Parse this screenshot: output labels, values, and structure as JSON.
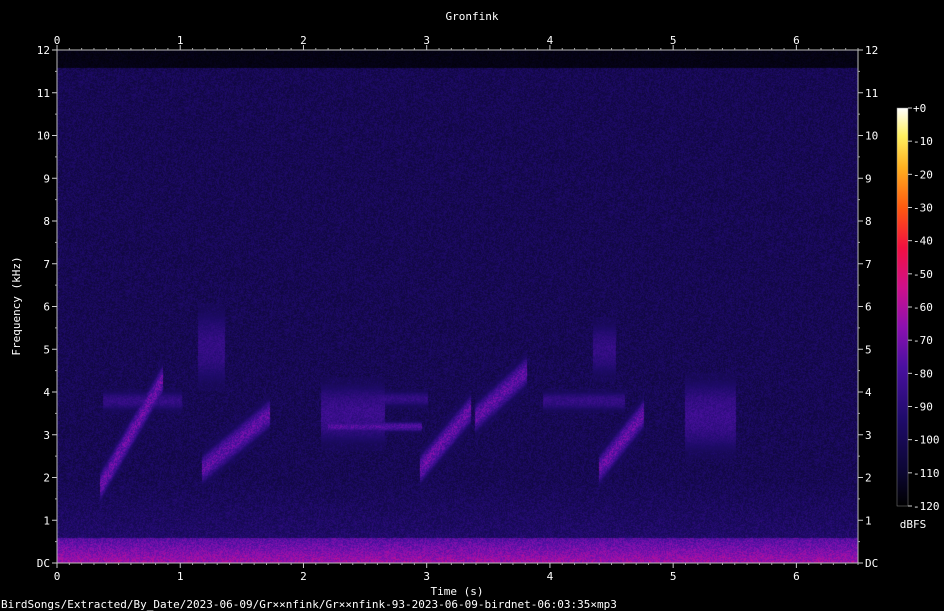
{
  "chart_data": {
    "type": "heatmap",
    "title": "Gronfink",
    "xlabel": "Time (s)",
    "ylabel": "Frequency (kHz)",
    "xlim": [
      0,
      6.5
    ],
    "ylim": [
      0,
      12
    ],
    "x_ticks": [
      "0",
      "1",
      "2",
      "3",
      "4",
      "5",
      "6"
    ],
    "y_ticks": [
      "DC",
      "1",
      "2",
      "3",
      "4",
      "5",
      "6",
      "7",
      "8",
      "9",
      "10",
      "11",
      "12"
    ],
    "colorbar": {
      "label": "dBFS",
      "range": [
        -120,
        0
      ],
      "ticks": [
        "+0",
        "-10",
        "-20",
        "-30",
        "-40",
        "-50",
        "-60",
        "-70",
        "-80",
        "-90",
        "-100",
        "-110",
        "-120"
      ]
    },
    "noise_floor_top_khz": 11.6,
    "low_freq_energy_below_khz": 0.6,
    "sound_events": [
      {
        "t_start": 0.35,
        "t_end": 0.85,
        "f_low": 1.8,
        "f_high": 4.3,
        "kind": "upsweep",
        "level_db": -70
      },
      {
        "t_start": 0.38,
        "t_end": 1.0,
        "f_low": 3.6,
        "f_high": 4.0,
        "kind": "band",
        "level_db": -85
      },
      {
        "t_start": 1.15,
        "t_end": 1.35,
        "f_low": 4.2,
        "f_high": 5.9,
        "kind": "click",
        "level_db": -85
      },
      {
        "t_start": 1.18,
        "t_end": 1.72,
        "f_low": 2.2,
        "f_high": 3.5,
        "kind": "upsweep",
        "level_db": -72
      },
      {
        "t_start": 2.15,
        "t_end": 2.65,
        "f_low": 2.8,
        "f_high": 4.2,
        "kind": "band",
        "level_db": -82
      },
      {
        "t_start": 2.2,
        "t_end": 2.95,
        "f_low": 3.1,
        "f_high": 3.3,
        "kind": "band",
        "level_db": -75
      },
      {
        "t_start": 2.6,
        "t_end": 3.0,
        "f_low": 3.7,
        "f_high": 4.0,
        "kind": "band",
        "level_db": -85
      },
      {
        "t_start": 2.95,
        "t_end": 3.35,
        "f_low": 2.2,
        "f_high": 3.6,
        "kind": "upsweep",
        "level_db": -70
      },
      {
        "t_start": 3.4,
        "t_end": 3.8,
        "f_low": 3.4,
        "f_high": 4.5,
        "kind": "upsweep",
        "level_db": -72
      },
      {
        "t_start": 3.95,
        "t_end": 4.6,
        "f_low": 3.6,
        "f_high": 4.0,
        "kind": "band",
        "level_db": -85
      },
      {
        "t_start": 4.35,
        "t_end": 4.52,
        "f_low": 4.4,
        "f_high": 5.6,
        "kind": "click",
        "level_db": -85
      },
      {
        "t_start": 4.4,
        "t_end": 4.75,
        "f_low": 2.2,
        "f_high": 3.5,
        "kind": "upsweep",
        "level_db": -70
      },
      {
        "t_start": 5.1,
        "t_end": 5.5,
        "f_low": 2.6,
        "f_high": 4.3,
        "kind": "band",
        "level_db": -82
      }
    ]
  },
  "footer": {
    "path": "BirdSongs/Extracted/By_Date/2023-06-09/Gr××nfink/Gr××nfink-93-2023-06-09-birdnet-06:03:35×mp3"
  }
}
